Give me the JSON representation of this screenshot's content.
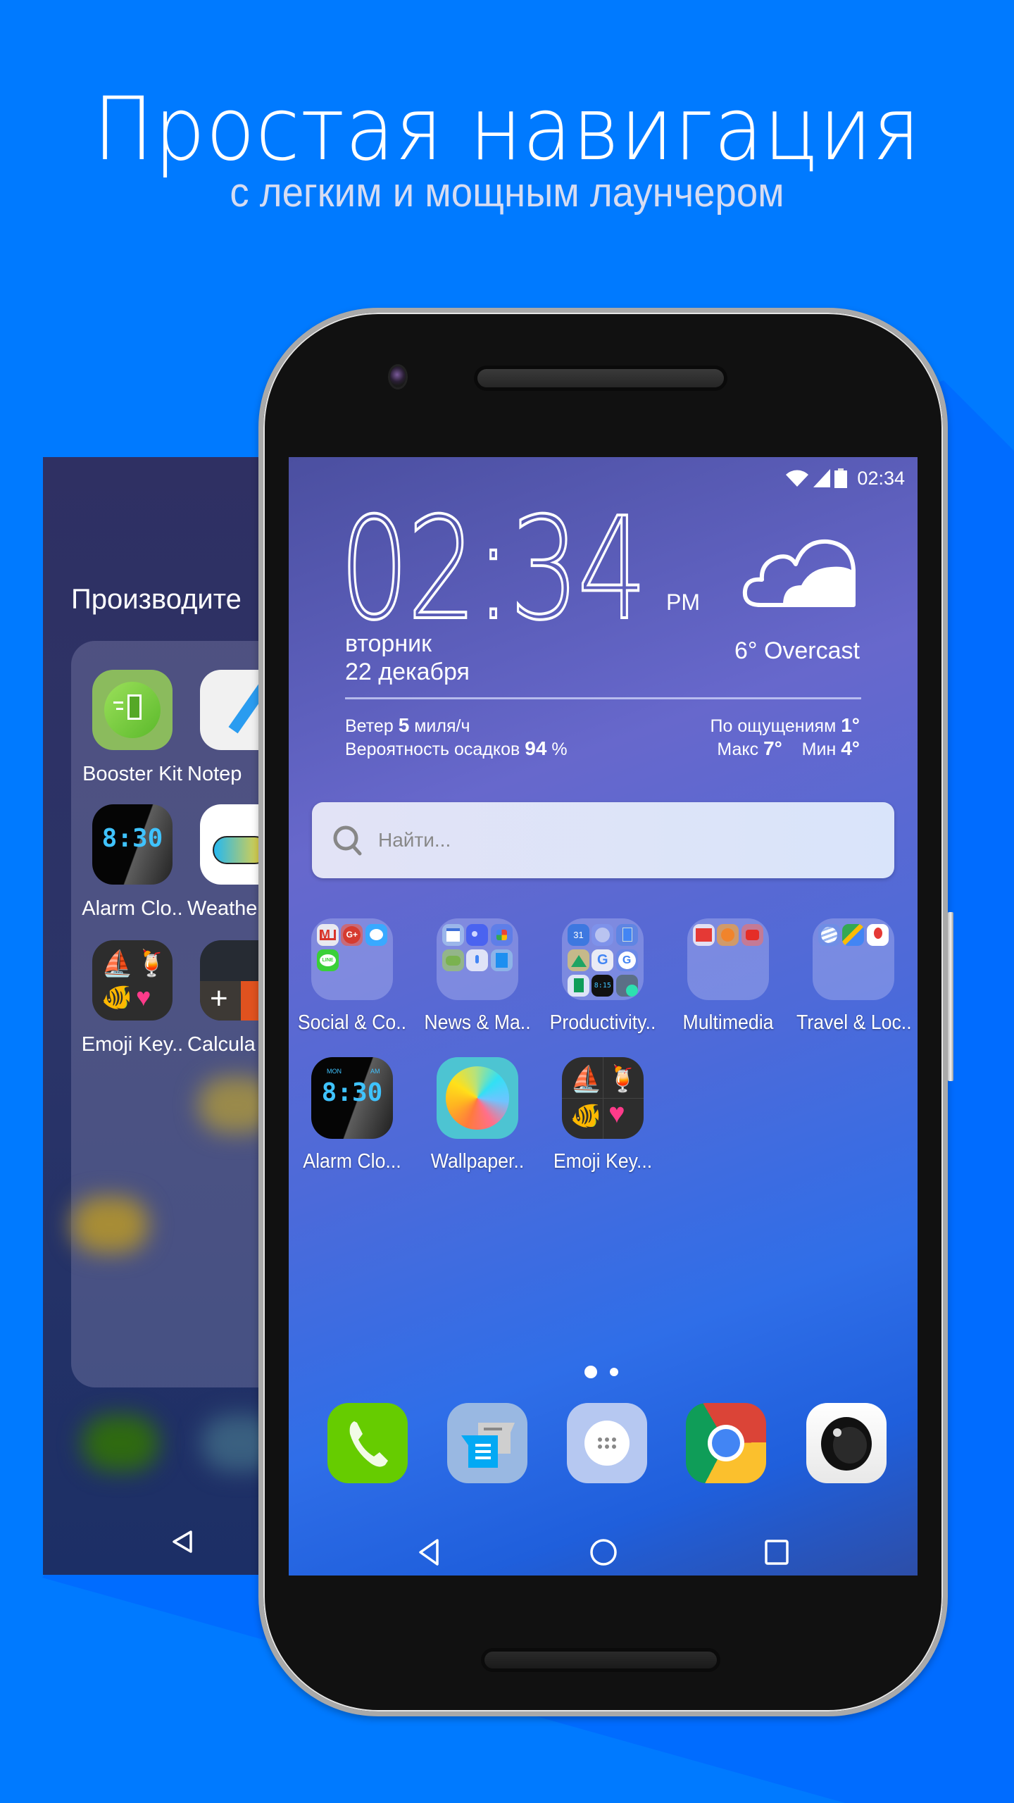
{
  "promo": {
    "headline": "Простая навигация",
    "subheadline": "с легким и мощным лаунчером",
    "background_color": "#007aff"
  },
  "back_screen": {
    "folder_title": "Производите",
    "apps": [
      {
        "label": "Booster Kit",
        "icon": "booster-kit-icon"
      },
      {
        "label": "Notep",
        "icon": "notepad-icon"
      },
      {
        "label": "Alarm Clo..",
        "icon": "alarm-clock-icon"
      },
      {
        "label": "Weathe",
        "icon": "weather-icon"
      },
      {
        "label": "Emoji Key..",
        "icon": "emoji-keyboard-icon"
      },
      {
        "label": "Calcula",
        "icon": "calculator-icon"
      }
    ]
  },
  "status_bar": {
    "time": "02:34",
    "icons": [
      "wifi-icon",
      "signal-icon",
      "battery-icon"
    ]
  },
  "clock_widget": {
    "time": "02:34",
    "ampm": "PM",
    "day": "вторник",
    "date": "22 декабря",
    "condition": "6° Overcast",
    "weather_icon": "cloud-icon",
    "wind_label": "Ветер",
    "wind_value": "5",
    "wind_unit": "миля/ч",
    "precip_label": "Вероятность осадков",
    "precip_value": "94",
    "precip_unit": "%",
    "feels_label": "По ощущениям",
    "feels_value": "1°",
    "max_label": "Макс",
    "max_value": "7°",
    "min_label": "Мин",
    "min_value": "4°"
  },
  "search": {
    "placeholder": "Найти...",
    "value": ""
  },
  "folders": [
    {
      "label": "Social & Co..",
      "apps": [
        "gmail",
        "google-plus",
        "messenger",
        "line"
      ]
    },
    {
      "label": "News & Ma..",
      "apps": [
        "google-news",
        "newsstand",
        "photos",
        "play-games",
        "voice-search",
        "books"
      ]
    },
    {
      "label": "Productivity..",
      "apps": [
        "calendar",
        "clock",
        "docs",
        "drive",
        "google",
        "google-search",
        "sheets",
        "alarm-clock",
        "calculator"
      ]
    },
    {
      "label": "Multimedia",
      "apps": [
        "video",
        "music",
        "youtube"
      ]
    },
    {
      "label": "Travel & Loc..",
      "apps": [
        "earth",
        "maps",
        "places"
      ]
    }
  ],
  "apps": [
    {
      "label": "Alarm Clo...",
      "icon": "alarm-clock-icon"
    },
    {
      "label": "Wallpaper..",
      "icon": "wallpaper-icon"
    },
    {
      "label": "Emoji Key...",
      "icon": "emoji-keyboard-icon"
    }
  ],
  "pages": {
    "count": 2,
    "current": 1
  },
  "dock": [
    {
      "name": "phone",
      "icon": "phone-icon"
    },
    {
      "name": "messages",
      "icon": "messages-icon"
    },
    {
      "name": "app-drawer",
      "icon": "app-drawer-icon"
    },
    {
      "name": "chrome",
      "icon": "chrome-icon"
    },
    {
      "name": "camera",
      "icon": "camera-icon"
    }
  ],
  "nav": [
    "back",
    "home",
    "recents"
  ]
}
